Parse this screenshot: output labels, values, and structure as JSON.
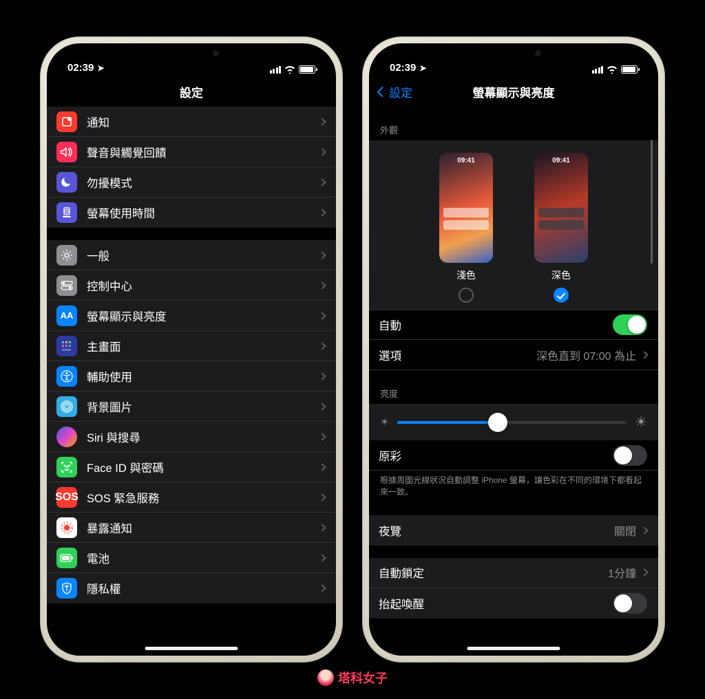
{
  "status": {
    "time": "02:39"
  },
  "left": {
    "title": "設定",
    "group1": [
      {
        "label": "通知"
      },
      {
        "label": "聲音與觸覺回饋"
      },
      {
        "label": "勿擾模式"
      },
      {
        "label": "螢幕使用時間"
      }
    ],
    "group2": [
      {
        "label": "一般"
      },
      {
        "label": "控制中心"
      },
      {
        "label": "螢幕顯示與亮度"
      },
      {
        "label": "主畫面"
      },
      {
        "label": "輔助使用"
      },
      {
        "label": "背景圖片"
      },
      {
        "label": "Siri 與搜尋"
      },
      {
        "label": "Face ID 與密碼"
      },
      {
        "label": "SOS 緊急服務"
      },
      {
        "label": "暴露通知"
      },
      {
        "label": "電池"
      },
      {
        "label": "隱私權"
      }
    ]
  },
  "right": {
    "back": "設定",
    "title": "螢幕顯示與亮度",
    "section_appearance": "外觀",
    "appearance": {
      "light_label": "淺色",
      "dark_label": "深色",
      "preview_time": "09:41"
    },
    "auto": {
      "label": "自動",
      "on": true
    },
    "options": {
      "label": "選項",
      "value": "深色直到 07:00 為止"
    },
    "section_brightness": "亮度",
    "brightness_percent": 44,
    "true_tone": {
      "label": "原彩",
      "on": false
    },
    "true_tone_foot": "根據周圍光線狀況自動調整 iPhone 螢幕，讓色彩在不同的環境下都看起來一致。",
    "night_shift": {
      "label": "夜覽",
      "value": "關閉"
    },
    "auto_lock": {
      "label": "自動鎖定",
      "value": "1分鐘"
    },
    "raise_wake": {
      "label": "抬起喚醒",
      "on": false
    }
  },
  "watermark": "塔科女子"
}
